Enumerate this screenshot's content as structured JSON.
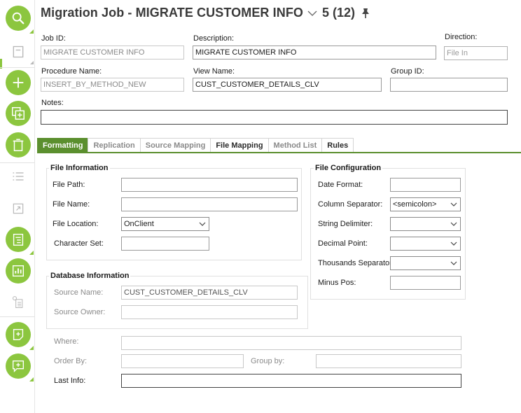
{
  "header": {
    "title": "Migration Job - MIGRATE CUSTOMER INFO",
    "count": "5 (12)"
  },
  "fields": {
    "job_id": {
      "label": "Job ID:",
      "value": "MIGRATE CUSTOMER INFO"
    },
    "description": {
      "label": "Description:",
      "value": "MIGRATE CUSTOMER INFO"
    },
    "direction": {
      "label": "Direction:",
      "value": "File In"
    },
    "procedure_name": {
      "label": "Procedure Name:",
      "value": "INSERT_BY_METHOD_NEW"
    },
    "view_name": {
      "label": "View Name:",
      "value": "CUST_CUSTOMER_DETAILS_CLV"
    },
    "group_id": {
      "label": "Group ID:",
      "value": ""
    },
    "notes": {
      "label": "Notes:",
      "value": ""
    }
  },
  "tabs": [
    {
      "label": "Formatting"
    },
    {
      "label": "Replication"
    },
    {
      "label": "Source Mapping"
    },
    {
      "label": "File Mapping"
    },
    {
      "label": "Method List"
    },
    {
      "label": "Rules"
    }
  ],
  "file_information": {
    "title": "File Information",
    "file_path": {
      "label": "File Path:",
      "value": ""
    },
    "file_name": {
      "label": "File Name:",
      "value": ""
    },
    "file_location": {
      "label": "File Location:",
      "value": "OnClient"
    },
    "character_set": {
      "label": "Character Set:",
      "value": ""
    }
  },
  "file_configuration": {
    "title": "File Configuration",
    "date_format": {
      "label": "Date Format:",
      "value": ""
    },
    "column_separator": {
      "label": "Column Separator:",
      "value": "<semicolon>"
    },
    "string_delimiter": {
      "label": "String Delimiter:",
      "value": ""
    },
    "decimal_point": {
      "label": "Decimal Point:",
      "value": ""
    },
    "thousands_separator": {
      "label": "Thousands Separator",
      "value": ""
    },
    "minus_pos": {
      "label": "Minus Pos:",
      "value": ""
    }
  },
  "database_information": {
    "title": "Database Information",
    "source_name": {
      "label": "Source Name:",
      "value": "CUST_CUSTOMER_DETAILS_CLV"
    },
    "source_owner": {
      "label": "Source Owner:",
      "value": ""
    }
  },
  "bottom": {
    "where": {
      "label": "Where:",
      "value": ""
    },
    "order_by": {
      "label": "Order By:",
      "value": ""
    },
    "group_by": {
      "label": "Group by:",
      "value": ""
    },
    "last_info": {
      "label": "Last Info:",
      "value": ""
    }
  },
  "colors": {
    "accent": "#8cc63f",
    "tab_active": "#5b8f2e"
  },
  "icons": {
    "sidebar": [
      "search-icon",
      "save-icon",
      "add-icon",
      "duplicate-icon",
      "delete-icon",
      "list-icon",
      "external-link-icon",
      "outline-icon",
      "chart-icon",
      "info-document-icon",
      "new-note-icon",
      "comment-add-icon"
    ]
  }
}
